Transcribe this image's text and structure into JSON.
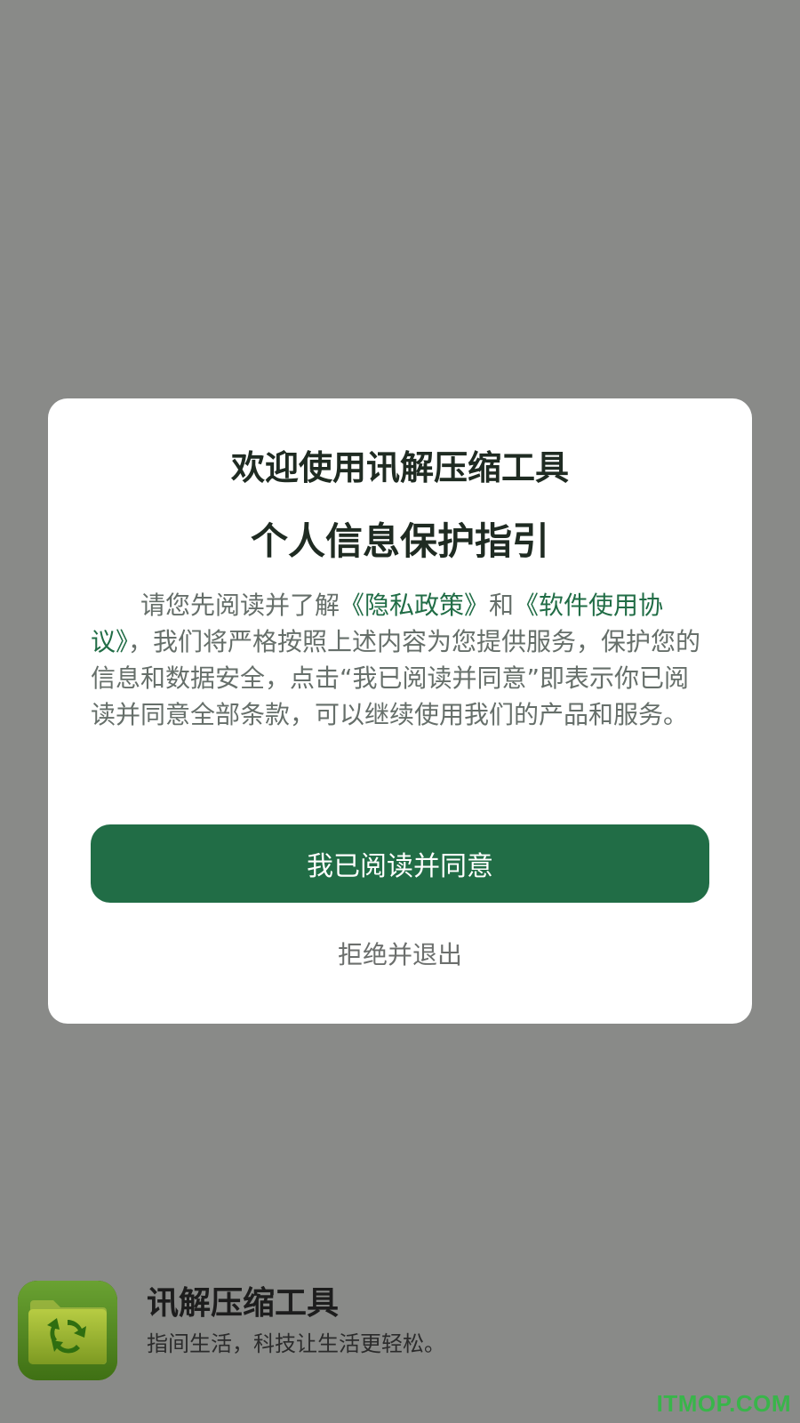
{
  "dialog": {
    "title_1": "欢迎使用讯解压缩工具",
    "title_2": "个人信息保护指引",
    "body": {
      "text_1": "请您先阅读并了解",
      "link_privacy": "《隐私政策》",
      "text_2": "和",
      "link_terms": "《软件使用协议》",
      "text_3": "，我们将严格按照上述内容为您提供服务，保护您的信息和数据安全，点击“我已阅读并同意”即表示你已阅读并同意全部条款，可以继续使用我们的产品和服务。"
    },
    "agree_label": "我已阅读并同意",
    "reject_label": "拒绝并退出"
  },
  "footer": {
    "app_name": "讯解压缩工具",
    "slogan": "指间生活，科技让生活更轻松。",
    "icon": "folder-recycle-icon"
  },
  "watermark": "ITMOP.COM",
  "colors": {
    "backdrop": "#898a88",
    "accent": "#216d46",
    "text_dark": "#1f2b22",
    "text_body": "#666f6a"
  }
}
